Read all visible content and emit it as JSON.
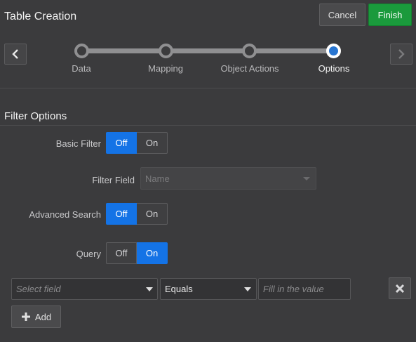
{
  "header": {
    "title": "Table Creation",
    "cancel_label": "Cancel",
    "finish_label": "Finish"
  },
  "train": {
    "steps": [
      {
        "label": "Data",
        "state": "visited"
      },
      {
        "label": "Mapping",
        "state": "visited"
      },
      {
        "label": "Object Actions",
        "state": "visited"
      },
      {
        "label": "Options",
        "state": "current"
      }
    ],
    "prev_icon": "chevron-left-icon",
    "next_icon": "chevron-right-icon"
  },
  "filter_options": {
    "section_title": "Filter Options",
    "basic_filter": {
      "label": "Basic Filter",
      "off": "Off",
      "on": "On",
      "selected": "Off"
    },
    "filter_field": {
      "label": "Filter Field",
      "value": "Name",
      "disabled": true
    },
    "advanced_search": {
      "label": "Advanced Search",
      "off": "Off",
      "on": "On",
      "selected": "Off"
    },
    "query": {
      "label": "Query",
      "off": "Off",
      "on": "On",
      "selected": "On"
    }
  },
  "query_row": {
    "field_placeholder": "Select field",
    "operator_value": "Equals",
    "value_placeholder": "Fill in the value",
    "remove_icon": "close-icon",
    "add_label": "Add",
    "add_icon": "plus-icon"
  },
  "colors": {
    "background": "#3b3b3d",
    "accent_blue": "#1473e6",
    "finish_green": "#1a9a3c"
  }
}
